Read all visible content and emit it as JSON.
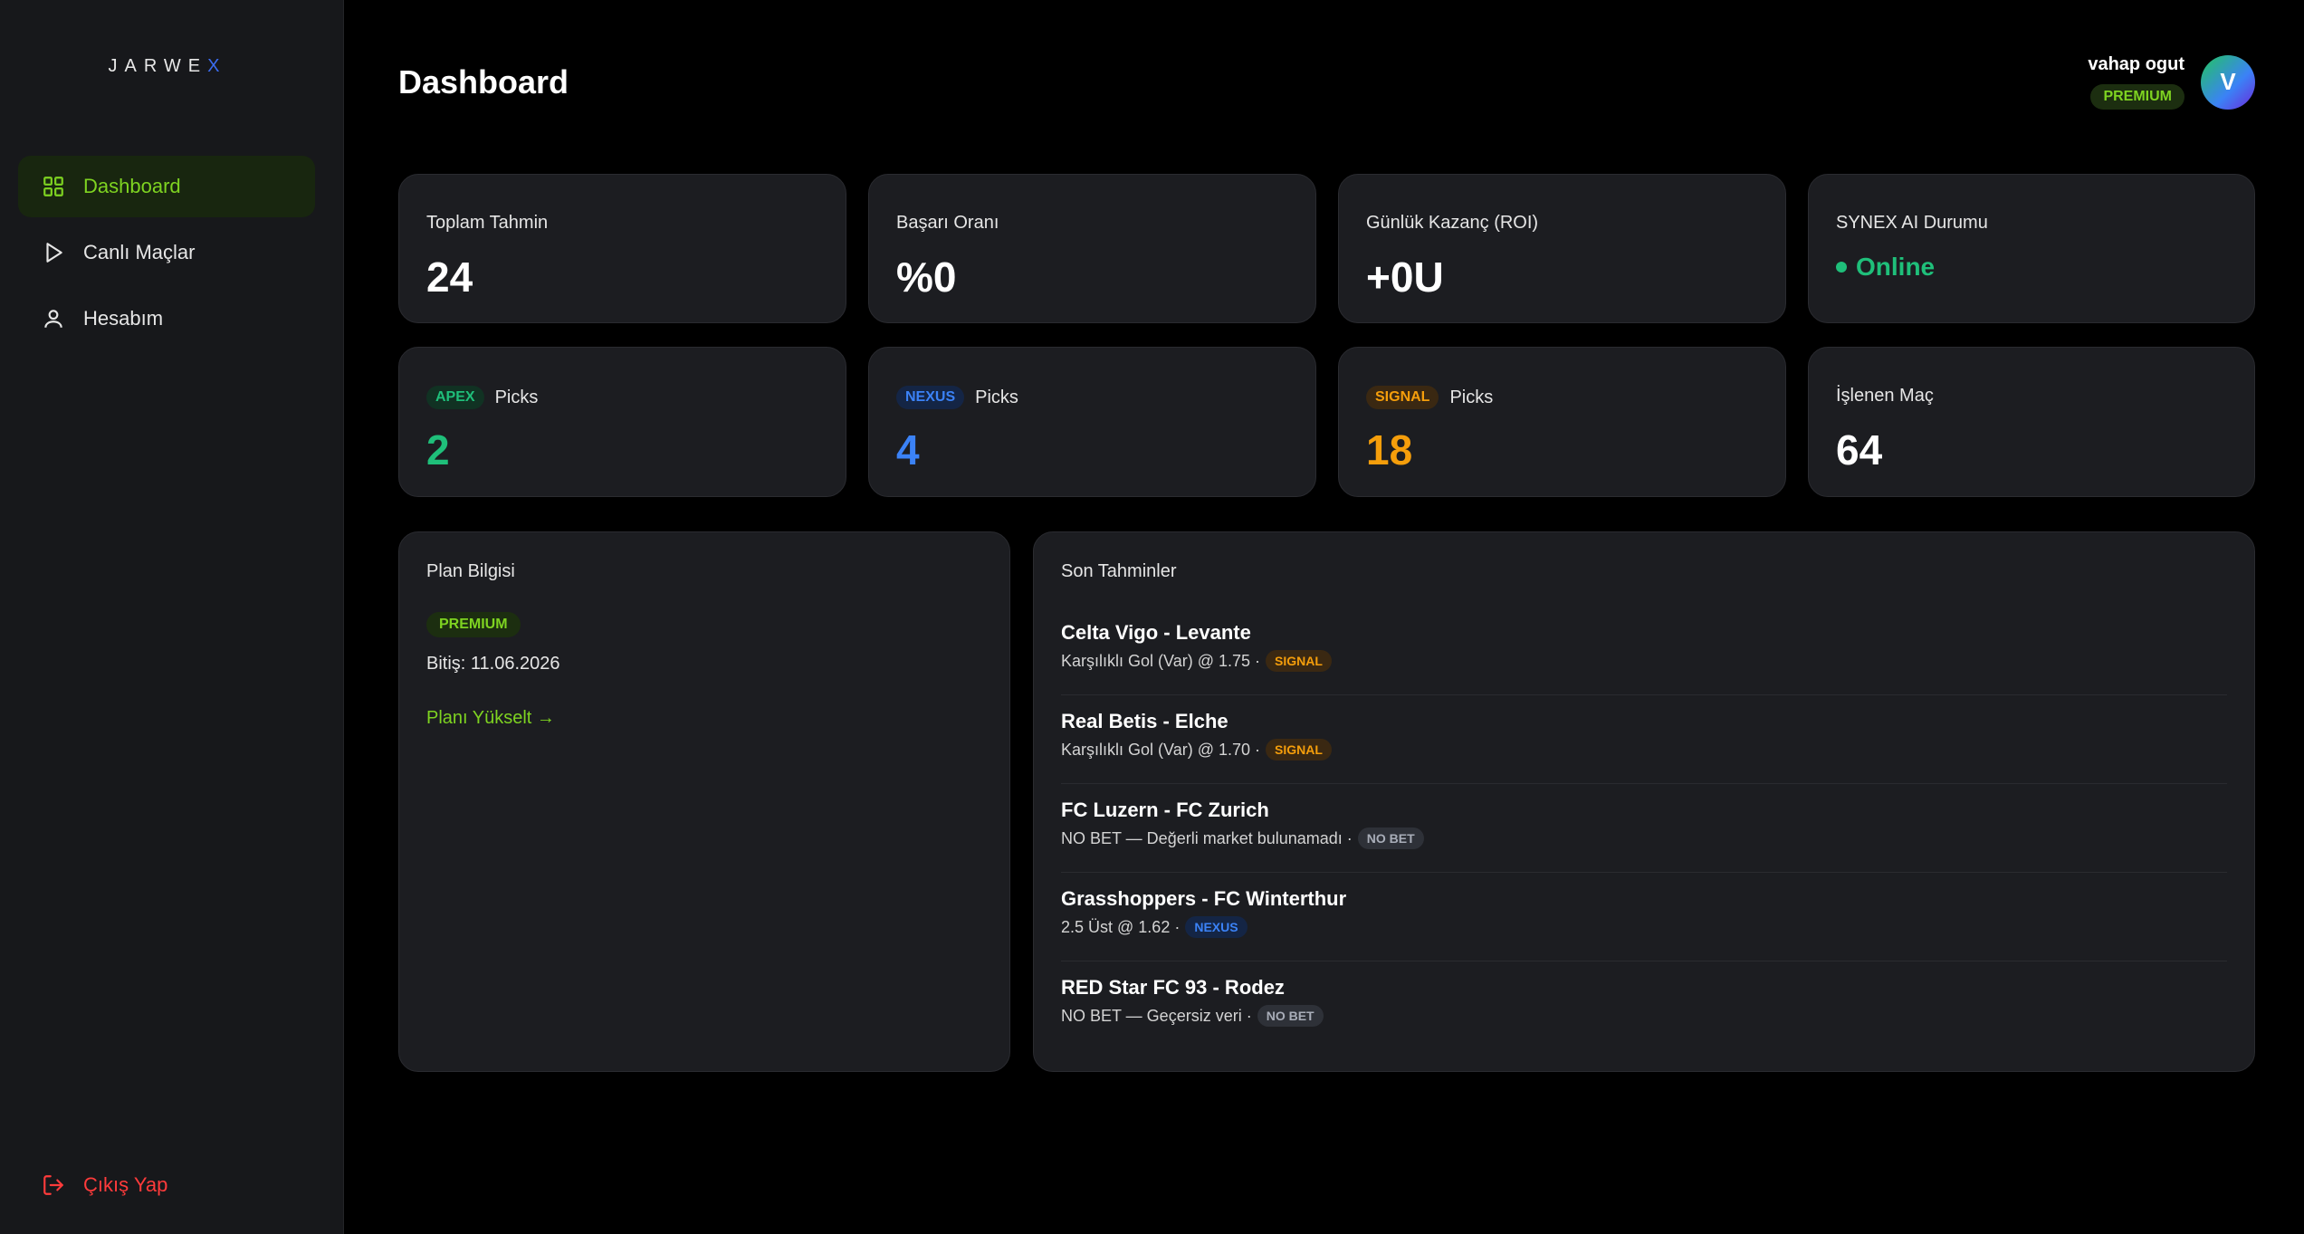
{
  "sidebar": {
    "logo": "JARWE",
    "logo_x": "X",
    "items": [
      {
        "label": "Dashboard",
        "icon": "grid-icon",
        "active": true
      },
      {
        "label": "Canlı Maçlar",
        "icon": "play-icon",
        "active": false
      },
      {
        "label": "Hesabım",
        "icon": "user-icon",
        "active": false
      }
    ],
    "logout_label": "Çıkış Yap"
  },
  "header": {
    "title": "Dashboard",
    "user_name": "vahap ogut",
    "user_plan": "PREMIUM",
    "avatar_initial": "V"
  },
  "stats": {
    "total_label": "Toplam Tahmin",
    "total_value": "24",
    "success_label": "Başarı Oranı",
    "success_value": "%0",
    "roi_label": "Günlük Kazanç (ROI)",
    "roi_value": "+0U",
    "ai_label": "SYNEX AI Durumu",
    "ai_status": "Online",
    "apex_tag": "APEX",
    "apex_label": "Picks",
    "apex_value": "2",
    "nexus_tag": "NEXUS",
    "nexus_label": "Picks",
    "nexus_value": "4",
    "signal_tag": "SIGNAL",
    "signal_label": "Picks",
    "signal_value": "18",
    "processed_label": "İşlenen Maç",
    "processed_value": "64"
  },
  "plan": {
    "title": "Plan Bilgisi",
    "badge": "PREMIUM",
    "expiry": "Bitiş: 11.06.2026",
    "upgrade": "Planı Yükselt →"
  },
  "predictions": {
    "title": "Son Tahminler",
    "items": [
      {
        "match": "Celta Vigo - Levante",
        "detail": "Karşılıklı Gol (Var) @ 1.75 ·",
        "tag": "SIGNAL"
      },
      {
        "match": "Real Betis - Elche",
        "detail": "Karşılıklı Gol (Var) @ 1.70 ·",
        "tag": "SIGNAL"
      },
      {
        "match": "FC Luzern - FC Zurich",
        "detail": "NO BET — Değerli market bulunamadı ·",
        "tag": "NO BET"
      },
      {
        "match": "Grasshoppers - FC Winterthur",
        "detail": "2.5 Üst @ 1.62 ·",
        "tag": "NEXUS"
      },
      {
        "match": "RED Star FC 93 - Rodez",
        "detail": "NO BET — Geçersiz veri ·",
        "tag": "NO BET"
      }
    ]
  },
  "colors": {
    "accent": "#7ed321",
    "apex": "#1fbf7a",
    "nexus": "#3b82f6",
    "signal": "#f59e0b",
    "danger": "#ff3b3b"
  }
}
